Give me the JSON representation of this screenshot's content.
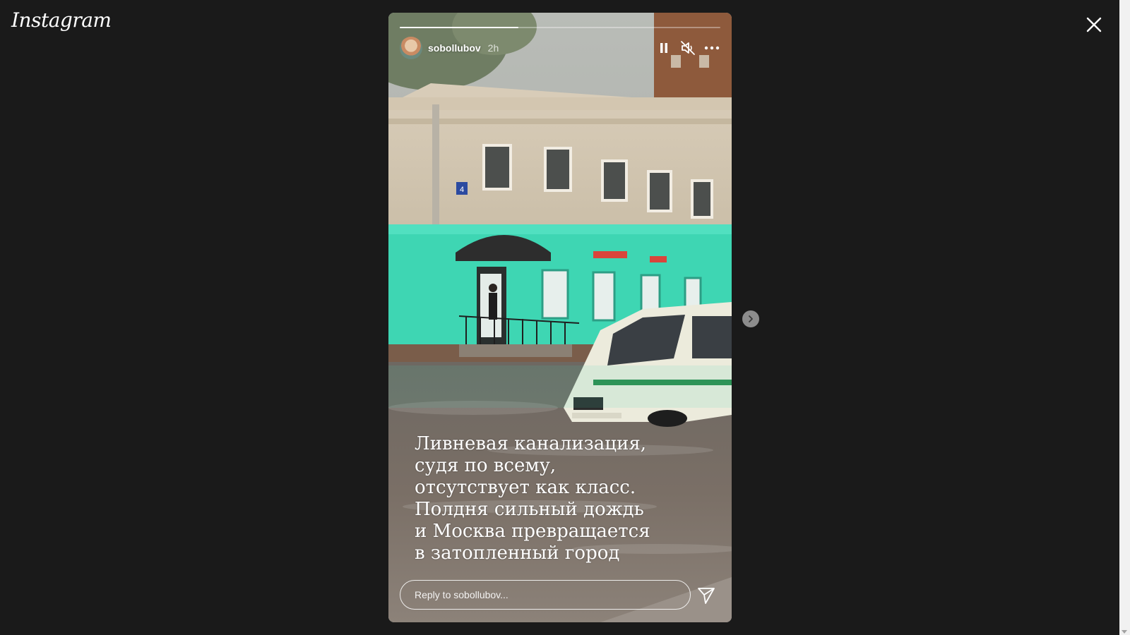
{
  "app": {
    "logo": "Instagram"
  },
  "story": {
    "username": "sobollubov",
    "timestamp": "2h",
    "progress_fraction": 0.37,
    "caption": "Ливневая канализация,\nсудя по всему,\nотсутствует как класс.\nПолдня сильный дождь\nи Москва превращается\nв затопленный город",
    "reply_placeholder": "Reply to sobollubov...",
    "scene_sign_number": "4"
  },
  "icons": {
    "close": "close-icon",
    "pause": "pause-icon",
    "mute": "muted-speaker-icon",
    "more": "more-options-icon",
    "send": "send-icon",
    "next": "chevron-right-icon"
  },
  "colors": {
    "page_background": "#1a1a1a",
    "storefront": "#3ed6b3",
    "text": "#ffffff"
  }
}
